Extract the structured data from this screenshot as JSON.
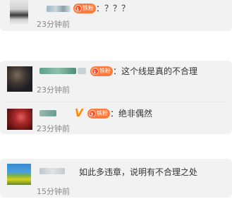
{
  "comments": [
    {
      "fan_badge": "铁粉",
      "fan_level": "1",
      "text": "：？？？",
      "time": "23分钟前"
    },
    {
      "fan_badge": "铁粉",
      "fan_level": "1",
      "text": "：这个线是真的不合理",
      "time": "23分钟前"
    },
    {
      "fan_badge": "铁粉",
      "fan_level": "3",
      "verified": "V",
      "text": "：绝非偶然",
      "time": "23分钟前"
    },
    {
      "text": "如此多违章，说明有不合理之处",
      "time": "15分钟前"
    }
  ],
  "colors": {
    "card_bg": "#f2f2f2",
    "fan_badge_bg": "#ff7a3a",
    "verified": "#ff8c00",
    "time": "#888888"
  }
}
